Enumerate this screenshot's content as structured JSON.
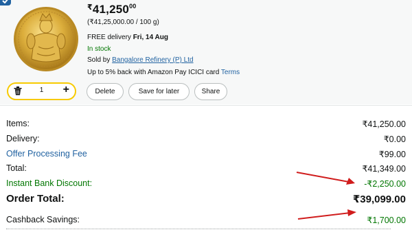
{
  "item": {
    "price_symbol": "₹",
    "price_whole": "41,250",
    "price_fraction": "00",
    "unit_price": "(₹41,25,000.00 / 100 g)",
    "delivery_prefix": "FREE delivery ",
    "delivery_date": "Fri, 14 Aug",
    "stock_status": "In stock",
    "sold_by_prefix": "Sold by ",
    "seller": "Bangalore Refinery (P) Ltd",
    "cashback_text": "Up to 5% back with Amazon Pay ICICI card ",
    "terms_link": "Terms",
    "quantity": "1",
    "image_icon": "gold-coin-icon"
  },
  "actions": {
    "delete_label": "Delete",
    "save_label": "Save for later",
    "share_label": "Share"
  },
  "summary": {
    "items_label": "Items:",
    "items_value": "₹41,250.00",
    "delivery_label": "Delivery:",
    "delivery_value": "₹0.00",
    "fee_label": "Offer Processing Fee",
    "fee_value": "₹99.00",
    "total_label": "Total:",
    "total_value": "₹41,349.00",
    "discount_label": "Instant Bank Discount:",
    "discount_value": "-₹2,250.00",
    "order_total_label": "Order Total:",
    "order_total_value": "₹39,099.00",
    "cashback_label": "Cashback Savings:",
    "cashback_value": "₹1,700.00"
  },
  "colors": {
    "link_blue": "#2162a1",
    "success_green": "#007600",
    "stepper_yellow": "#f7ca00",
    "arrow_red": "#d01c1c"
  }
}
